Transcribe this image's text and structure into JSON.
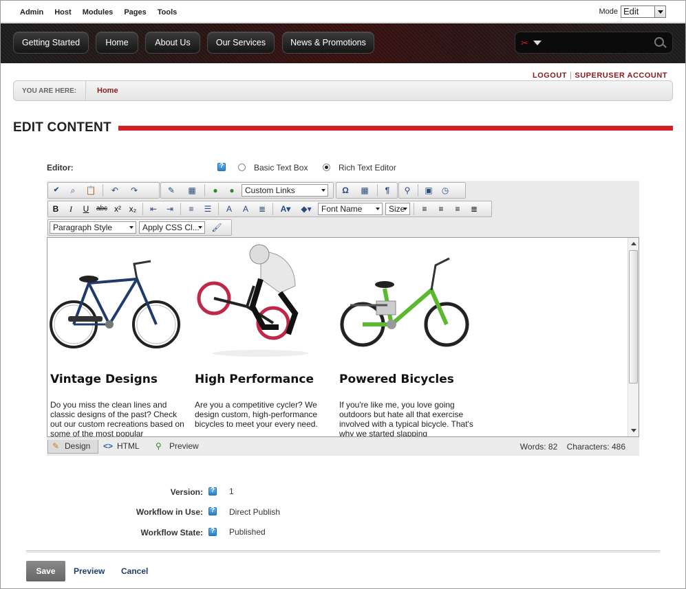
{
  "control_bar": {
    "menu": [
      "Admin",
      "Host",
      "Modules",
      "Pages",
      "Tools"
    ],
    "mode_label": "Mode",
    "mode_value": "Edit"
  },
  "nav": {
    "items": [
      "Getting Started",
      "Home",
      "About Us",
      "Our Services",
      "News & Promotions"
    ],
    "search_placeholder": ""
  },
  "user_links": {
    "logout": "LOGOUT",
    "account": "SUPERUSER ACCOUNT"
  },
  "breadcrumb": {
    "label": "YOU ARE HERE:",
    "current": "Home"
  },
  "page_title": "EDIT CONTENT",
  "editor": {
    "label": "Editor:",
    "options": [
      "Basic Text Box",
      "Rich Text Editor"
    ],
    "selected": "Rich Text Editor",
    "toolbar": {
      "custom_links": "Custom Links",
      "font_name": "Font Name",
      "size": "Size",
      "paragraph_style": "Paragraph Style",
      "css_class": "Apply CSS Cl..."
    },
    "columns": [
      {
        "title": "Vintage Designs",
        "text": "Do you miss the clean lines and classic designs of the past? Check out our custom recreations based on some of the most popular"
      },
      {
        "title": "High Performance",
        "text": "Are you a competitive cycler? We design custom, high-performance bicycles to meet your every need."
      },
      {
        "title": "Powered Bicycles",
        "text": "If you're like me, you love going outdoors but hate all that exercise involved with a typical bicycle. That's why we started slapping"
      }
    ],
    "modes": [
      "Design",
      "HTML",
      "Preview"
    ],
    "active_mode": "Design",
    "words": "Words: 82",
    "characters": "Characters: 486"
  },
  "meta": {
    "version_label": "Version:",
    "version_value": "1",
    "workflow_label": "Workflow in Use:",
    "workflow_value": "Direct Publish",
    "state_label": "Workflow State:",
    "state_value": "Published"
  },
  "actions": {
    "save": "Save",
    "preview": "Preview",
    "cancel": "Cancel"
  },
  "colors": {
    "accent_red": "#d11f24",
    "link_dark_red": "#8b1a1a",
    "link_blue": "#1f3d6b"
  }
}
